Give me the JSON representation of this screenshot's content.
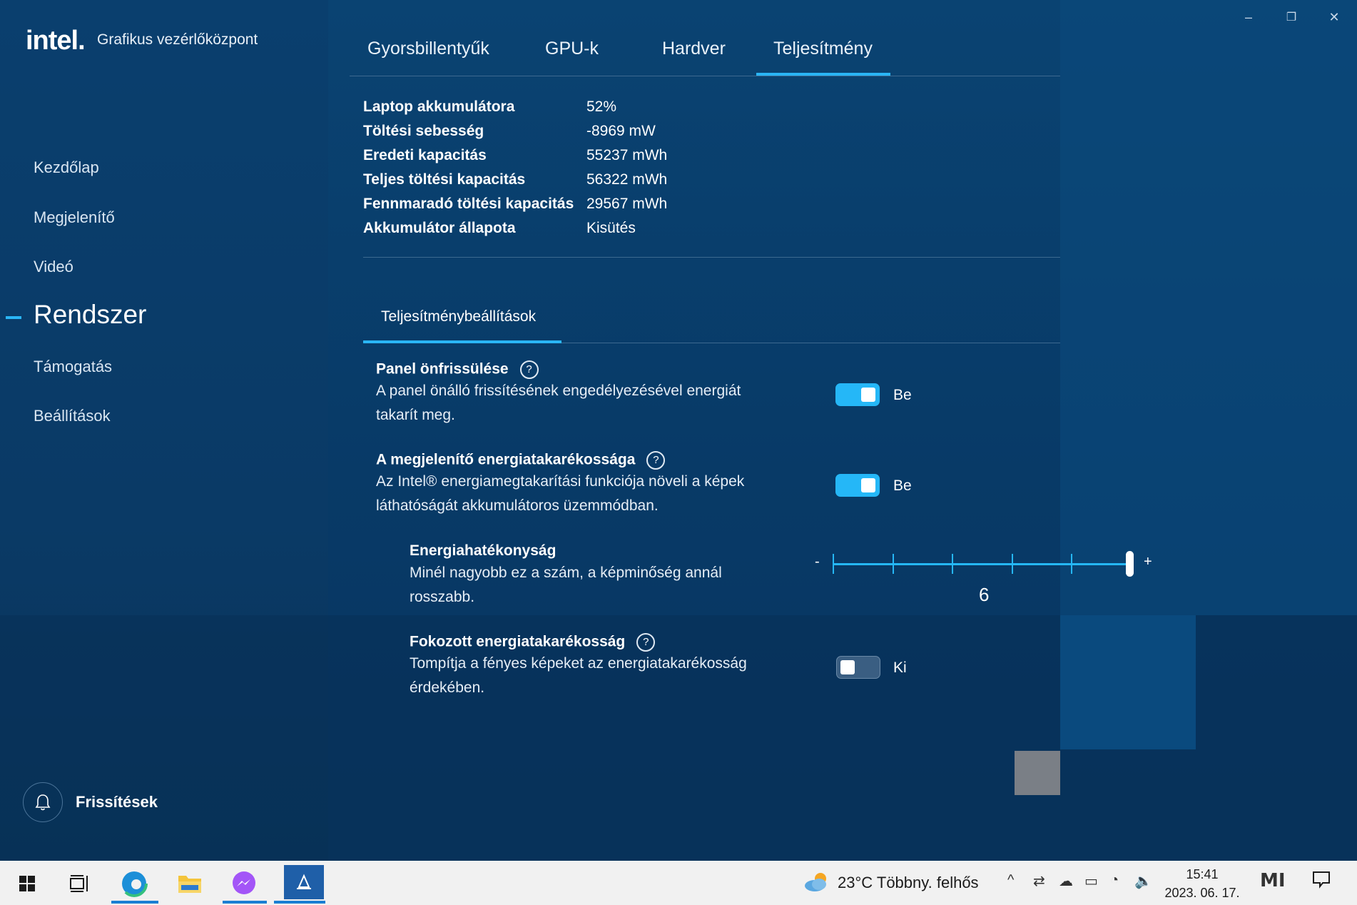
{
  "app": {
    "logo": "intel.",
    "title": "Grafikus vezérlőközpont"
  },
  "window_controls": {
    "minimize": "–",
    "restore": "❐",
    "close": "✕"
  },
  "tabs": [
    {
      "label": "Gyorsbillentyűk"
    },
    {
      "label": "GPU-k"
    },
    {
      "label": "Hardver"
    },
    {
      "label": "Teljesítmény",
      "active": true
    }
  ],
  "sidebar": {
    "items": [
      {
        "label": "Kezdőlap"
      },
      {
        "label": "Megjelenítő"
      },
      {
        "label": "Videó"
      },
      {
        "label": "Rendszer",
        "active": true
      },
      {
        "label": "Támogatás"
      },
      {
        "label": "Beállítások"
      }
    ],
    "updates_label": "Frissítések"
  },
  "battery": [
    {
      "key": "Laptop akkumulátora",
      "value": "52%"
    },
    {
      "key": "Töltési sebesség",
      "value": "-8969 mW"
    },
    {
      "key": "Eredeti kapacitás",
      "value": "55237 mWh"
    },
    {
      "key": "Teljes töltési kapacitás",
      "value": "56322 mWh"
    },
    {
      "key": "Fennmaradó töltési kapacitás",
      "value": "29567 mWh"
    },
    {
      "key": "Akkumulátor állapota",
      "value": "Kisütés"
    }
  ],
  "subtab": {
    "label": "Teljesítménybeállítások"
  },
  "settings": {
    "panel_refresh": {
      "title": "Panel önfrissülése",
      "help": "?",
      "desc_line1": "A panel önálló frissítésének engedélyezésével energiát",
      "desc_line2": "takarít meg.",
      "state": "Be",
      "on": true
    },
    "display_power": {
      "title": "A megjelenítő energiatakarékossága",
      "help": "?",
      "desc_line1": "Az Intel® energiamegtakarítási funkciója növeli a képek",
      "desc_line2": "láthatóságát akkumulátoros üzemmódban.",
      "state": "Be",
      "on": true
    },
    "efficiency": {
      "title": "Energiahatékonyság",
      "desc_line1": "Minél nagyobb ez a szám, a képminőség annál",
      "desc_line2": "rosszabb.",
      "min_label": "-",
      "max_label": "+",
      "value": "6",
      "level": 6,
      "max_level": 6
    },
    "enhanced_power": {
      "title": "Fokozott energiatakarékosság",
      "help": "?",
      "desc_line1": "Tompítja a fényes képeket az energiatakarékosság",
      "desc_line2": "érdekében.",
      "state": "Ki",
      "on": false
    }
  },
  "taskbar": {
    "weather_temp": "23°C",
    "weather_desc": "Többny. felhős",
    "time": "15:41",
    "date": "2023. 06. 17."
  },
  "colors": {
    "accent": "#25b7f7",
    "background": "#0a3f6e",
    "taskbar": "#f1f1f1"
  }
}
